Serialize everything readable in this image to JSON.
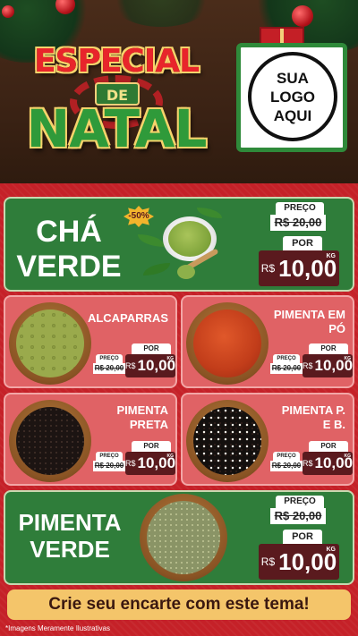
{
  "header": {
    "title_line1": "ESPECIAL",
    "title_de": "DE",
    "title_line2": "NATAL",
    "logo_text": "SUA\nLOGO\nAQUI"
  },
  "featured_top": {
    "name": "CHÁ\nVERDE",
    "discount_badge": "-50%",
    "preco_label": "PREÇO",
    "old_price": "R$ 20,00",
    "por_label": "POR",
    "currency": "R$",
    "new_price": "10,00",
    "unit": "KG"
  },
  "grid_items": [
    {
      "name": "ALCAPARRAS",
      "preco_label": "PREÇO",
      "old_price": "R$ 20,00",
      "por_label": "POR",
      "currency": "R$",
      "new_price": "10,00",
      "unit": "KG"
    },
    {
      "name": "PIMENTA EM\nPÓ",
      "preco_label": "PREÇO",
      "old_price": "R$ 20,00",
      "por_label": "POR",
      "currency": "R$",
      "new_price": "10,00",
      "unit": "KG"
    },
    {
      "name": "PIMENTA\nPRETA",
      "preco_label": "PREÇO",
      "old_price": "R$ 20,00",
      "por_label": "POR",
      "currency": "R$",
      "new_price": "10,00",
      "unit": "KG"
    },
    {
      "name": "PIMENTA P.\nE B.",
      "preco_label": "PREÇO",
      "old_price": "R$ 20,00",
      "por_label": "POR",
      "currency": "R$",
      "new_price": "10,00",
      "unit": "KG"
    }
  ],
  "featured_bottom": {
    "name": "PIMENTA\nVERDE",
    "preco_label": "PREÇO",
    "old_price": "R$ 20,00",
    "por_label": "POR",
    "currency": "R$",
    "new_price": "10,00",
    "unit": "KG"
  },
  "cta_text": "Crie seu encarte com este tema!",
  "footnote": "*Imagens Meramente Ilustrativas",
  "colors": {
    "red_bg": "#c52128",
    "green_card": "#2f7d3a",
    "pink_card": "#e06265",
    "price_dark": "#5a1a1e",
    "cta_yellow": "#f4c56a"
  }
}
